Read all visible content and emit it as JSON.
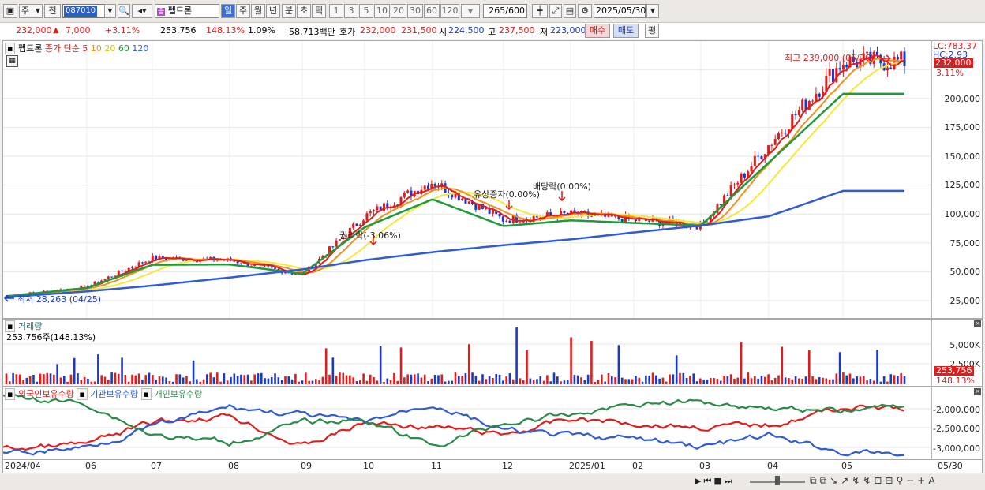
{
  "toolbar": {
    "mode1": "주",
    "prefix": "전",
    "code": "087010",
    "stock_name": "펩트론",
    "periods": [
      "일",
      "주",
      "월",
      "년",
      "분",
      "초",
      "틱"
    ],
    "selected_period": "일",
    "intervals": [
      "1",
      "3",
      "5",
      "10",
      "20",
      "30",
      "60",
      "120"
    ],
    "count": "265",
    "count_max": "/600",
    "date": "2025/05/30",
    "icons": [
      "layout-icon",
      "dropdown-icon",
      "search-icon",
      "speaker-icon",
      "chart-type-icon",
      "compare-icon",
      "save-icon",
      "gear-icon"
    ]
  },
  "quote": {
    "price": "232,000",
    "change_arrow": "▲",
    "change": "7,000",
    "change_pct": "+3.11%",
    "volume": "253,756",
    "volume_ratio": "148.13%",
    "turnover": "1.09%",
    "amount": "58,713백만",
    "hoga_label": "호가",
    "ask": "232,000",
    "bid": "231,500",
    "open_label": "시",
    "open": "224,500",
    "high_label": "고",
    "high": "237,500",
    "low_label": "저",
    "low": "223,000",
    "buy_label": "매수",
    "sell_label": "매도",
    "eval_label": "평"
  },
  "price_panel": {
    "name": "펩트론",
    "ma_label": "종가 단순",
    "ma_periods": [
      "5",
      "10",
      "20",
      "60",
      "120"
    ],
    "lc": "LC:783.37",
    "hc": "HC:2.93",
    "current_tag": "232,000",
    "current_pct": "3.11%",
    "high_note": "최고 239,000 (05/26)",
    "low_note": "최저 28,263 (04/25)",
    "events": [
      "권리락(-3.06%)",
      "유상증자(0.00%)",
      "배당락(0.00%)"
    ],
    "yticks": [
      "200,000",
      "175,000",
      "150,000",
      "125,000",
      "100,000",
      "75,000",
      "50,000",
      "25,000"
    ]
  },
  "volume_panel": {
    "title": "거래량",
    "value": "253,756주(148.13%)",
    "yticks": [
      "5,000K",
      "2,500K"
    ],
    "tag": "253,756",
    "tag_pct": "148.13%"
  },
  "holding_panel": {
    "series": [
      "외국인보유수량",
      "기관보유수량",
      "개인보유수량"
    ],
    "yticks": [
      "-2,000,000",
      "-2,500,000",
      "-3,000,000"
    ]
  },
  "x_axis": [
    "2024/04",
    "06",
    "07",
    "08",
    "09",
    "10",
    "11",
    "12",
    "2025/01",
    "02",
    "03",
    "04",
    "05",
    "05/30"
  ],
  "colors": {
    "up": "#e21b1b",
    "down": "#1a39c9",
    "ma5": "#e21b1b",
    "ma10": "#f0901c",
    "ma20": "#f5e83a",
    "ma60": "#1f9a3a",
    "ma120": "#2f5bd8",
    "foreign": "#e21b1b",
    "inst": "#2f5bd8",
    "indiv": "#2a8a4a"
  },
  "chart_data": {
    "type": "line",
    "x": [
      "2024/04",
      "06",
      "07",
      "08",
      "09",
      "10",
      "11",
      "12",
      "2025/01",
      "02",
      "03",
      "04",
      "05"
    ],
    "series": [
      {
        "name": "5",
        "values": [
          29000,
          37000,
          62000,
          60000,
          47000,
          98000,
          128000,
          95000,
          100000,
          95000,
          90000,
          160000,
          232000
        ]
      },
      {
        "name": "120",
        "values": [
          28000,
          33000,
          38000,
          45000,
          52000,
          60000,
          67000,
          73000,
          78000,
          84000,
          90000,
          98000,
          120000
        ]
      }
    ],
    "ylim": [
      15000,
      250000
    ]
  }
}
